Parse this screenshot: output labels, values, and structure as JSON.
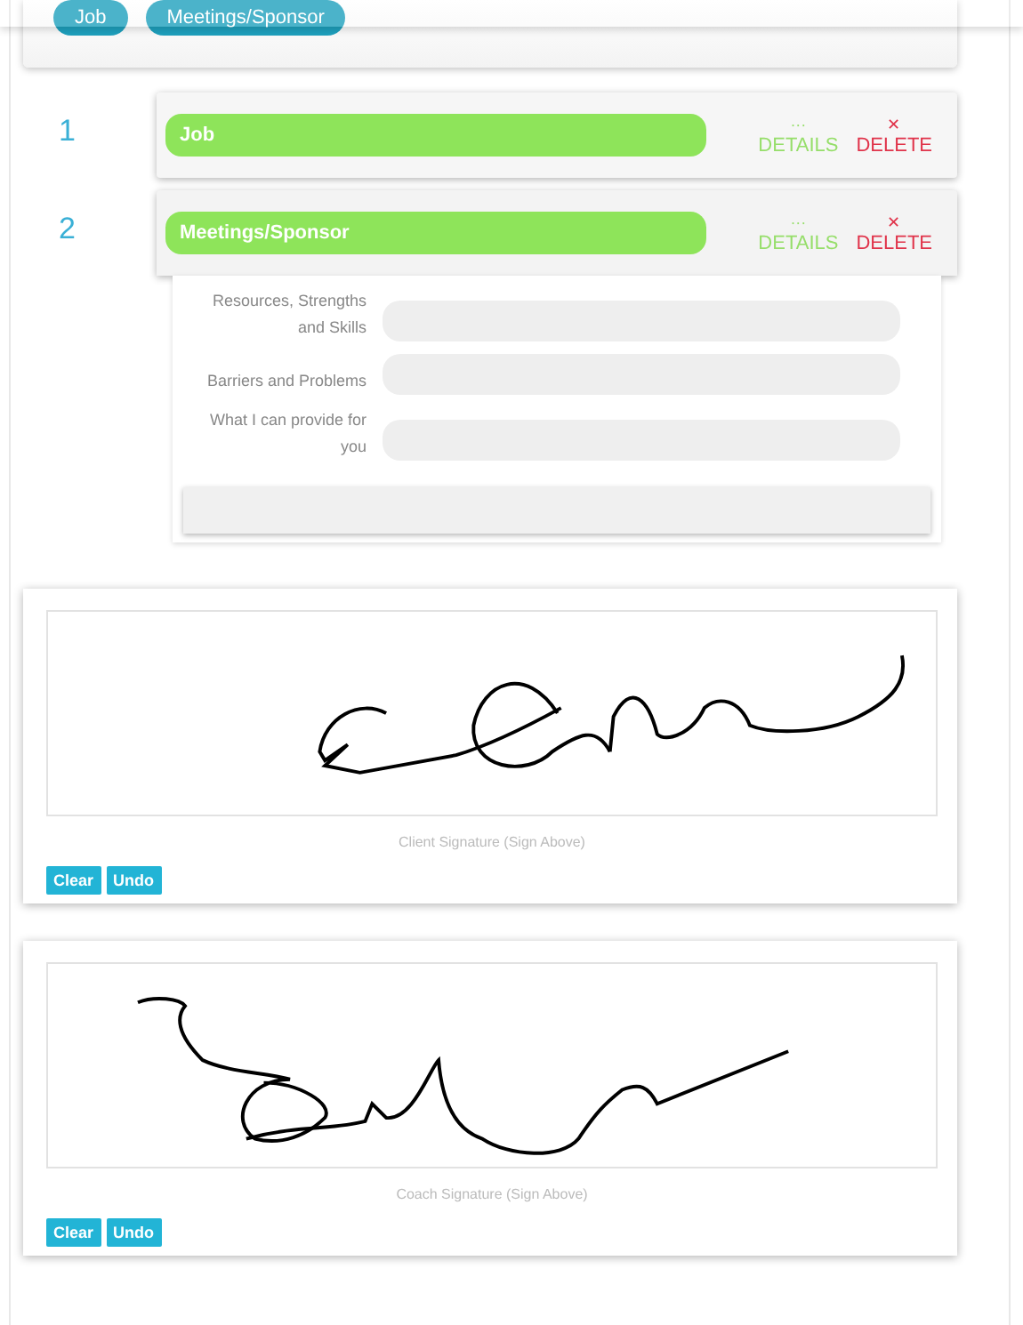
{
  "chips": [
    {
      "label": "Job"
    },
    {
      "label": "Meetings/Sponsor"
    }
  ],
  "items": [
    {
      "number": "1",
      "label": "Job",
      "details_icon": "···",
      "details": "DETAILS",
      "delete_icon": "✕",
      "delete": "DELETE",
      "expanded": false
    },
    {
      "number": "2",
      "label": "Meetings/Sponsor",
      "details_icon": "···",
      "details": "DETAILS",
      "delete_icon": "✕",
      "delete": "DELETE",
      "expanded": true,
      "fields": [
        {
          "label": "Resources, Strengths and Skills"
        },
        {
          "label": "Barriers and Problems"
        },
        {
          "label": "What I can provide for you"
        }
      ]
    }
  ],
  "signatures": [
    {
      "kind": "client",
      "caption": "Client Signature (Sign Above)",
      "buttons": [
        "Clear",
        "Undo"
      ]
    },
    {
      "kind": "coach",
      "caption": "Coach Signature (Sign Above)",
      "buttons": [
        "Clear",
        "Undo"
      ]
    }
  ]
}
